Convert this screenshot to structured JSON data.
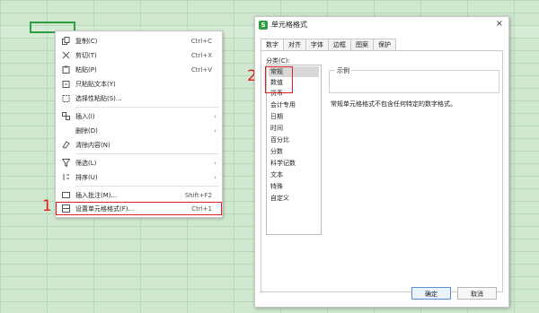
{
  "context_menu": {
    "items": [
      {
        "label": "复制(C)",
        "shortcut": "Ctrl+C",
        "icon": "copy-icon"
      },
      {
        "label": "剪切(T)",
        "shortcut": "Ctrl+X",
        "icon": "scissors-icon"
      },
      {
        "label": "粘贴(P)",
        "shortcut": "Ctrl+V",
        "icon": "paste-icon"
      },
      {
        "label": "只粘贴文本(Y)",
        "shortcut": "",
        "icon": "paste-text-icon"
      },
      {
        "label": "选择性粘贴(S)...",
        "shortcut": "",
        "icon": "paste-special-icon"
      },
      {
        "label": "插入(I)",
        "shortcut": "",
        "icon": "insert-icon"
      },
      {
        "label": "删除(D)",
        "shortcut": "",
        "icon": ""
      },
      {
        "label": "清除内容(N)",
        "shortcut": "",
        "icon": "eraser-icon"
      },
      {
        "label": "筛选(L)",
        "shortcut": "",
        "icon": "filter-icon"
      },
      {
        "label": "排序(U)",
        "shortcut": "",
        "icon": "sort-icon"
      },
      {
        "label": "插入批注(M)...",
        "shortcut": "Shift+F2",
        "icon": "comment-icon"
      },
      {
        "label": "设置单元格格式(F)...",
        "shortcut": "Ctrl+1",
        "icon": "format-cells-icon"
      }
    ],
    "arrow": "›"
  },
  "dialog": {
    "title": "单元格格式",
    "close": "×",
    "tabs": [
      "数字",
      "对齐",
      "字体",
      "边框",
      "图案",
      "保护"
    ],
    "category_label": "分类(C):",
    "categories": [
      "常规",
      "数值",
      "货币",
      "会计专用",
      "日期",
      "时间",
      "百分比",
      "分数",
      "科学记数",
      "文本",
      "特殊",
      "自定义"
    ],
    "selected_category": "常规",
    "example_label": "示例",
    "description": "常规单元格格式不包含任何特定的数字格式。",
    "ok": "确定",
    "cancel": "取消"
  },
  "annotations": {
    "step1": "1",
    "step2": "2"
  },
  "colors": {
    "accent_green": "#2e9e44",
    "annotation_red": "#e02020"
  }
}
